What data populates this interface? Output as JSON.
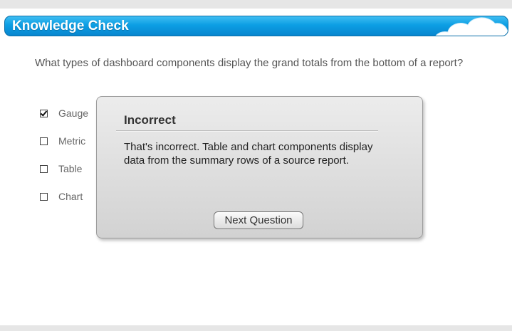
{
  "header": {
    "title": "Knowledge Check"
  },
  "question": {
    "text": "What types of dashboard components display the grand totals from the bottom of a report?"
  },
  "options": [
    {
      "label": "Gauge",
      "checked": true
    },
    {
      "label": "Metric",
      "checked": false
    },
    {
      "label": "Table",
      "checked": false
    },
    {
      "label": "Chart",
      "checked": false
    }
  ],
  "feedback": {
    "title": "Incorrect",
    "body": "That's incorrect. Table and chart components display data from the summary rows of a source report.",
    "button_label": "Next Question"
  },
  "colors": {
    "title_bar": "#0c9ee4",
    "title_text": "#ffffff"
  }
}
